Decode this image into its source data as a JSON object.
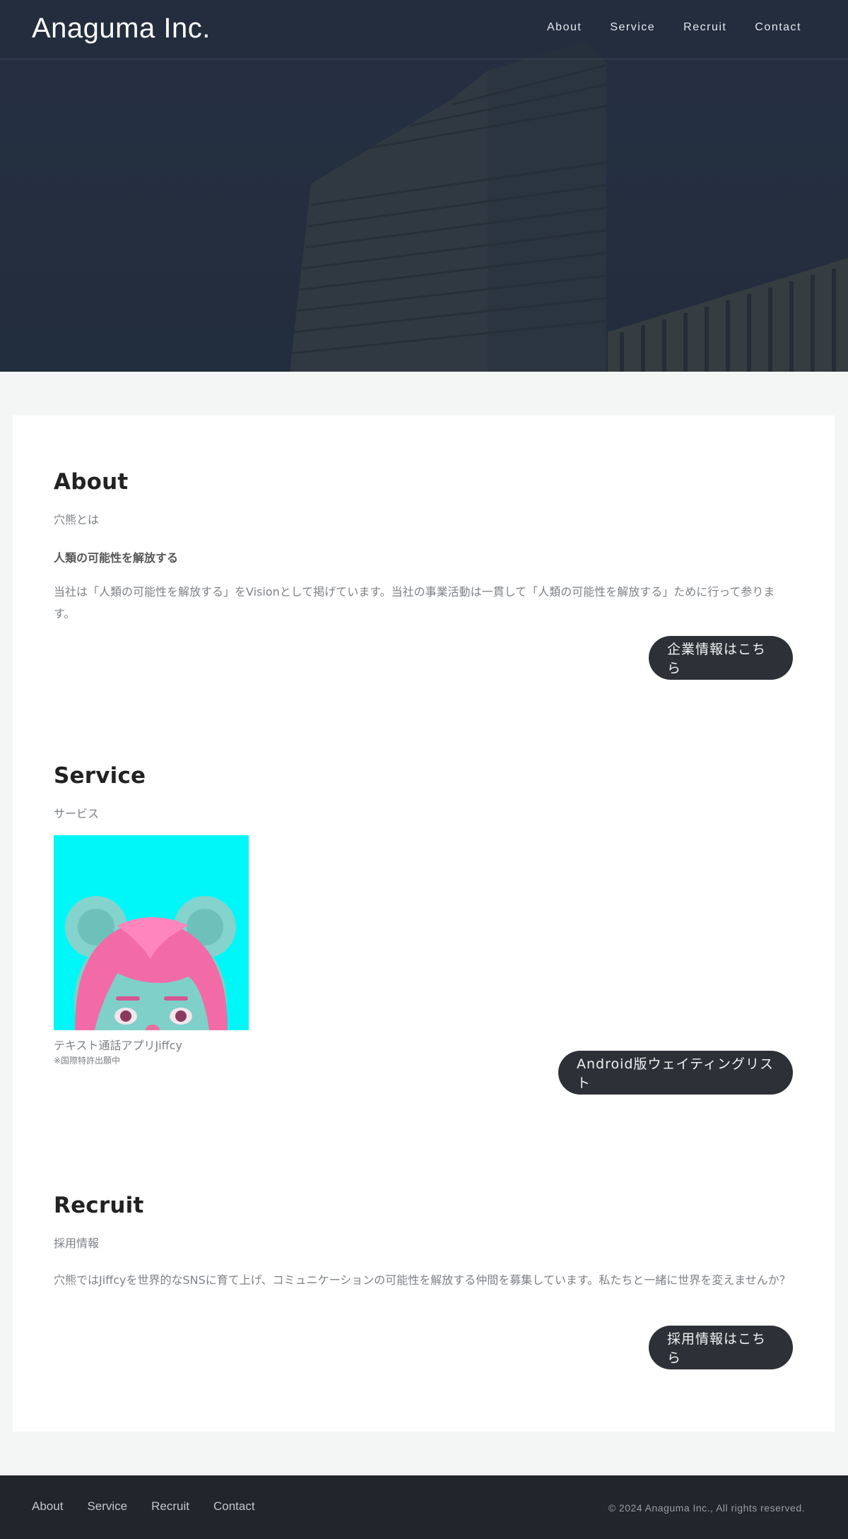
{
  "header": {
    "logo": "Anaguma Inc.",
    "nav": [
      "About",
      "Service",
      "Recruit",
      "Contact"
    ]
  },
  "about": {
    "title": "About",
    "subtitle": "穴熊とは",
    "lead": "人類の可能性を解放する",
    "body": "当社は「人類の可能性を解放する」をVisionとして掲げています。当社の事業活動は一貫して「人類の可能性を解放する」ために行って参ります。",
    "button": "企業情報はこちら"
  },
  "service": {
    "title": "Service",
    "subtitle": "サービス",
    "caption": "テキスト通話アプリJiffcy",
    "note": "※国際特許出願中",
    "button": "Android版ウェイティングリスト"
  },
  "recruit": {
    "title": "Recruit",
    "subtitle": "採用情報",
    "body": "穴熊ではJiffcyを世界的なSNSに育て上げ、コミュニケーションの可能性を解放する仲間を募集しています。私たちと一緒に世界を変えませんか？",
    "button": "採用情報はこちら"
  },
  "footer": {
    "nav": [
      "About",
      "Service",
      "Recruit",
      "Contact"
    ],
    "copyright": "© 2024 Anaguma Inc., All rights reserved."
  },
  "colors": {
    "hero_overlay": "#273142",
    "button_bg": "#2d3036",
    "footer_bg": "#21252c",
    "thumb_bg": "#00f7f7"
  }
}
